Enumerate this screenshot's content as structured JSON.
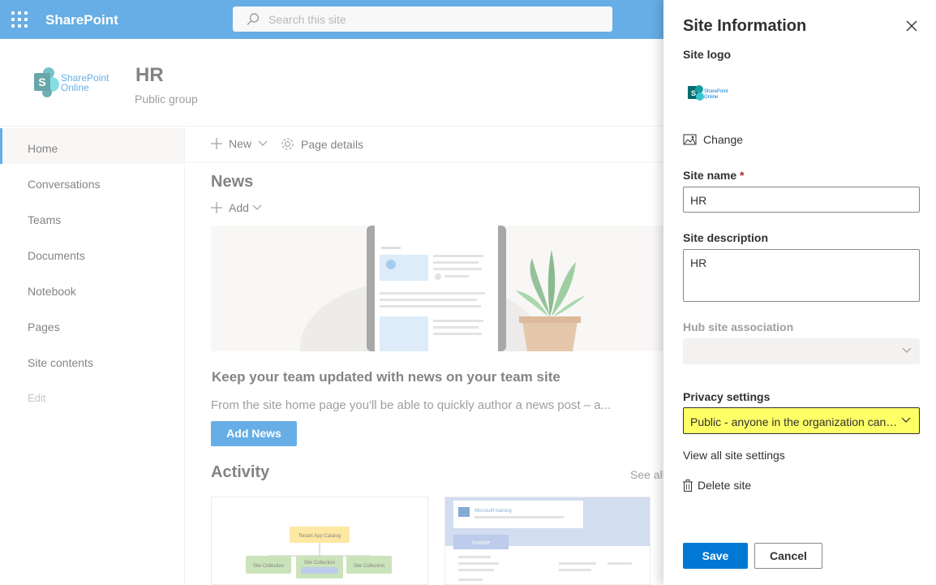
{
  "suite": {
    "brand": "SharePoint",
    "search_placeholder": "Search this site"
  },
  "site": {
    "title": "HR",
    "subtitle": "Public group",
    "logo_text_line1": "SharePoint",
    "logo_text_line2": "Online"
  },
  "nav": {
    "items": [
      {
        "label": "Home"
      },
      {
        "label": "Conversations"
      },
      {
        "label": "Teams"
      },
      {
        "label": "Documents"
      },
      {
        "label": "Notebook"
      },
      {
        "label": "Pages"
      },
      {
        "label": "Site contents"
      },
      {
        "label": "Edit"
      }
    ]
  },
  "commands": {
    "new_label": "New",
    "page_details_label": "Page details"
  },
  "news": {
    "heading": "News",
    "add_label": "Add",
    "headline": "Keep your team updated with news on your team site",
    "description": "From the site home page you'll be able to quickly author a news post – a...",
    "add_news_button": "Add News"
  },
  "activity": {
    "heading": "Activity",
    "see_all": "See all",
    "card1": {
      "top_label": "Tenant App Catalog",
      "mid_label": "Site Collection",
      "left_label": "Site Collection",
      "right_label": "Site Collection"
    },
    "card2": {
      "brand": "Microsoft training",
      "tag": "Invoice"
    }
  },
  "panel": {
    "title": "Site Information",
    "site_logo_label": "Site logo",
    "logo_text_line1": "SharePoint",
    "logo_text_line2": "Online",
    "change_label": "Change",
    "site_name_label": "Site name",
    "required_marker": "*",
    "site_name_value": "HR",
    "site_description_label": "Site description",
    "site_description_value": "HR",
    "hub_label": "Hub site association",
    "hub_value": "",
    "privacy_label": "Privacy settings",
    "privacy_value": "Public - anyone in the organization can access this site",
    "view_settings_label": "View all site settings",
    "delete_label": "Delete site",
    "save_label": "Save",
    "cancel_label": "Cancel"
  },
  "colors": {
    "brand_blue": "#0078d4",
    "privacy_highlight": "#ffff66"
  }
}
